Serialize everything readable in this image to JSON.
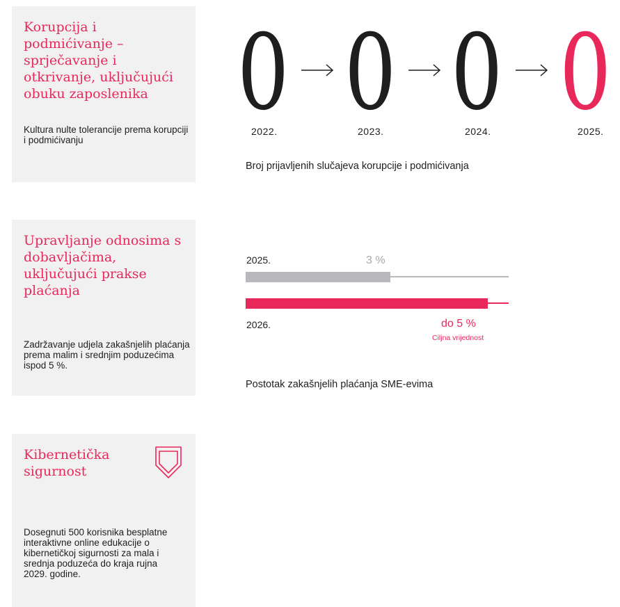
{
  "cards": [
    {
      "title": "Korupcija i podmićivanje – sprječavanje i otkrivanje, uključujući obuku zaposlenika",
      "text": "Kultura nulte tolerancije prema korupciji i podmićivanju"
    },
    {
      "title": "Upravljanje odnosima s dobavljačima, uključujući prakse plaćanja",
      "text": "Zadržavanje udjela zakašnjelih plaćanja prema malim i srednjim poduzećima ispod 5 %."
    },
    {
      "title": "Kibernetička sigurnost",
      "text": "Dosegnuti 500 korisnika besplatne interaktivne online edukacije o kibernetičkoj sigurnosti za mala i srednja poduzeća do kraja rujna 2029. godine.",
      "icon": "shield-icon"
    }
  ],
  "corruption": {
    "years": [
      "2022.",
      "2023.",
      "2024.",
      "2025."
    ],
    "values": [
      "0",
      "0",
      "0",
      "0"
    ],
    "caption": "Broj prijavljenih slučajeva korupcije i podmićivanja"
  },
  "payments": {
    "row1_label": "2025.",
    "row1_value": "3 %",
    "row1_fraction": 0.55,
    "row2_label": "2026.",
    "row2_value": "do 5 %",
    "row2_sub": "Ciljna vrijednost",
    "row2_fraction": 0.92,
    "caption": "Postotak zakašnjelih plaćanja SME-evima"
  },
  "colors": {
    "accent": "#e8285b",
    "grey_bar": "#b9b9bd",
    "card_bg": "#f1f1f1",
    "text": "#1e1e1e"
  }
}
